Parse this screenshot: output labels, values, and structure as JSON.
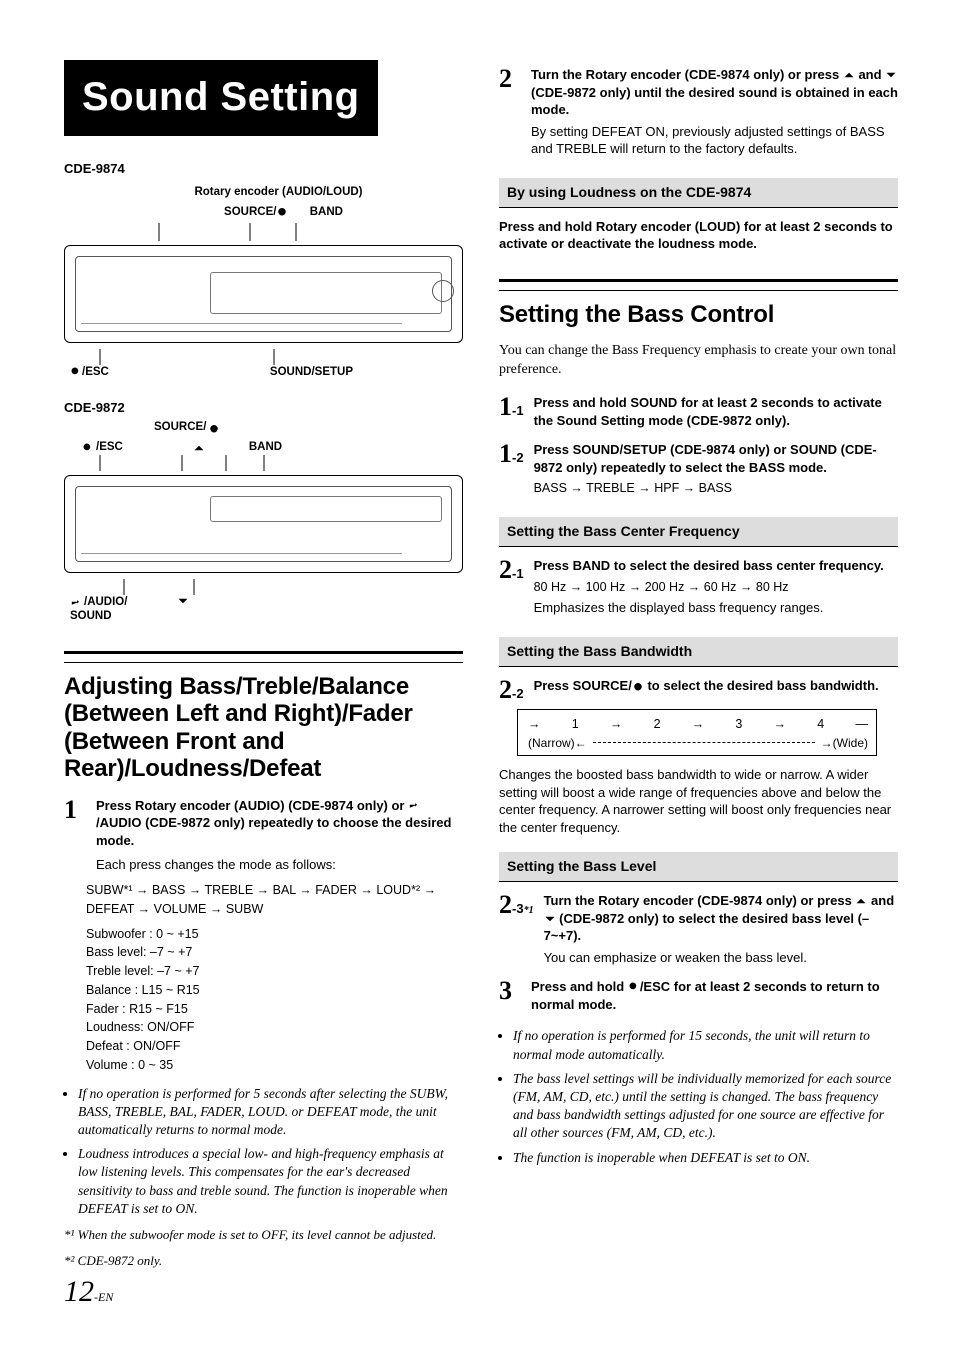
{
  "title": "Sound Setting",
  "models": {
    "a": "CDE-9874",
    "b": "CDE-9872"
  },
  "anno9874": {
    "rotary": "Rotary encoder (AUDIO/LOUD)",
    "source": "SOURCE/",
    "power_after": " ",
    "band": "BAND",
    "esc": "/ESC",
    "sound_setup": "SOUND/SETUP"
  },
  "anno9872": {
    "source": "SOURCE/",
    "esc": "/ESC",
    "band": "BAND",
    "audio": "/AUDIO/",
    "sound": "SOUND"
  },
  "sec_adjust": {
    "heading": "Adjusting Bass/Treble/Balance (Between Left and Right)/Fader (Between Front and Rear)/Loudness/Defeat",
    "step1": {
      "line1a": "Press ",
      "btn1": "Rotary encoder (AUDIO)",
      "line1b": " (CDE-9874 only) or ",
      "btn2": "/AUDIO",
      "line1c": " (CDE-9872 only) repeatedly to choose the desired mode.",
      "sub": "Each press changes the mode as follows:",
      "flow": "SUBW*¹ → BASS → TREBLE → BAL → FADER → LOUD*² → DEFEAT → VOLUME → SUBW",
      "values": [
        "Subwoofer : 0 ~ +15",
        "Bass level: –7 ~ +7",
        "Treble level: –7 ~ +7",
        "Balance : L15 ~ R15",
        "Fader : R15 ~ F15",
        "Loudness: ON/OFF",
        "Defeat : ON/OFF",
        "Volume : 0 ~ 35"
      ]
    },
    "notes": [
      "If no operation is performed for 5 seconds after selecting the SUBW, BASS, TREBLE, BAL, FADER, LOUD. or DEFEAT mode, the unit automatically returns to normal mode.",
      "Loudness introduces a special low- and high-frequency emphasis at low listening levels. This compensates for the ear's decreased sensitivity to bass and treble sound. The function is inoperable when DEFEAT is set to ON."
    ],
    "footrefs": [
      "*¹ When the subwoofer mode is set to OFF, its level cannot be adjusted.",
      "*² CDE-9872 only."
    ]
  },
  "step2_top": {
    "a": "Turn the ",
    "btn": "Rotary encoder",
    "b": " (CDE-9874 only) or press ",
    "c": " and ",
    "d": " (CDE-9872 only) until the desired sound is obtained in each mode.",
    "sub": "By setting DEFEAT ON, previously adjusted settings of BASS and TREBLE will return to the factory defaults."
  },
  "loudness": {
    "heading": "By using Loudness on the CDE-9874",
    "body_a": "Press and hold ",
    "btn": "Rotary encoder (LOUD)",
    "body_b": " for at least 2 seconds to activate or deactivate the loudness mode."
  },
  "sec_bass": {
    "heading": "Setting the Bass Control",
    "intro": "You can change the Bass Frequency emphasis to create your own tonal preference.",
    "s11": {
      "a": "Press and hold ",
      "btn": "SOUND",
      "b": " for at least 2 seconds to activate the Sound Setting mode (CDE-9872 only)."
    },
    "s12": {
      "a": "Press ",
      "btn1": "SOUND/SETUP",
      "b": " (CDE-9874 only) or ",
      "btn2": "SOUND",
      "c": " (CDE-9872 only) repeatedly to select the BASS mode.",
      "flow": "BASS → TREBLE → HPF → BASS"
    },
    "sub_center": {
      "heading": "Setting the Bass Center Frequency",
      "s": {
        "a": "Press ",
        "btn": "BAND",
        "b": " to select the desired bass center frequency."
      },
      "flow": "80 Hz → 100 Hz → 200 Hz → 60 Hz → 80 Hz",
      "note": "Emphasizes the displayed bass frequency ranges."
    },
    "sub_bw": {
      "heading": "Setting the Bass Bandwidth",
      "s": {
        "a": "Press ",
        "btn": "SOURCE/",
        "b": " to select the desired bass bandwidth."
      },
      "row": {
        "n1": "1",
        "n2": "2",
        "n3": "3",
        "n4": "4",
        "nl": "(Narrow)",
        "wr": "(Wide)"
      },
      "note": "Changes the boosted bass bandwidth to wide or narrow. A wider setting will boost a wide range of frequencies above and below the center frequency. A narrower setting will boost only frequencies near the center frequency."
    },
    "sub_level": {
      "heading": "Setting the Bass Level",
      "s": {
        "a": "Turn the ",
        "btn": "Rotary encoder",
        "b": " (CDE-9874 only) or press ",
        "c": " and ",
        "d": " (CDE-9872 only) to select the desired bass level (–7~+7).",
        "sub": "You can emphasize or weaken the bass level."
      }
    },
    "s3": {
      "a": "Press and hold ",
      "btn": "/ESC",
      "b": " for at least 2 seconds to return to normal mode."
    },
    "notes": [
      "If no operation is performed for 15 seconds, the unit will return to normal mode automatically.",
      "The bass level settings will be individually memorized for each source (FM, AM, CD, etc.) until the setting is changed. The bass frequency and bass bandwidth settings adjusted for one source are effective for all other sources (FM, AM, CD, etc.).",
      "The function is inoperable when DEFEAT is set to ON."
    ]
  },
  "page": {
    "num": "12",
    "suffix": "-EN"
  }
}
